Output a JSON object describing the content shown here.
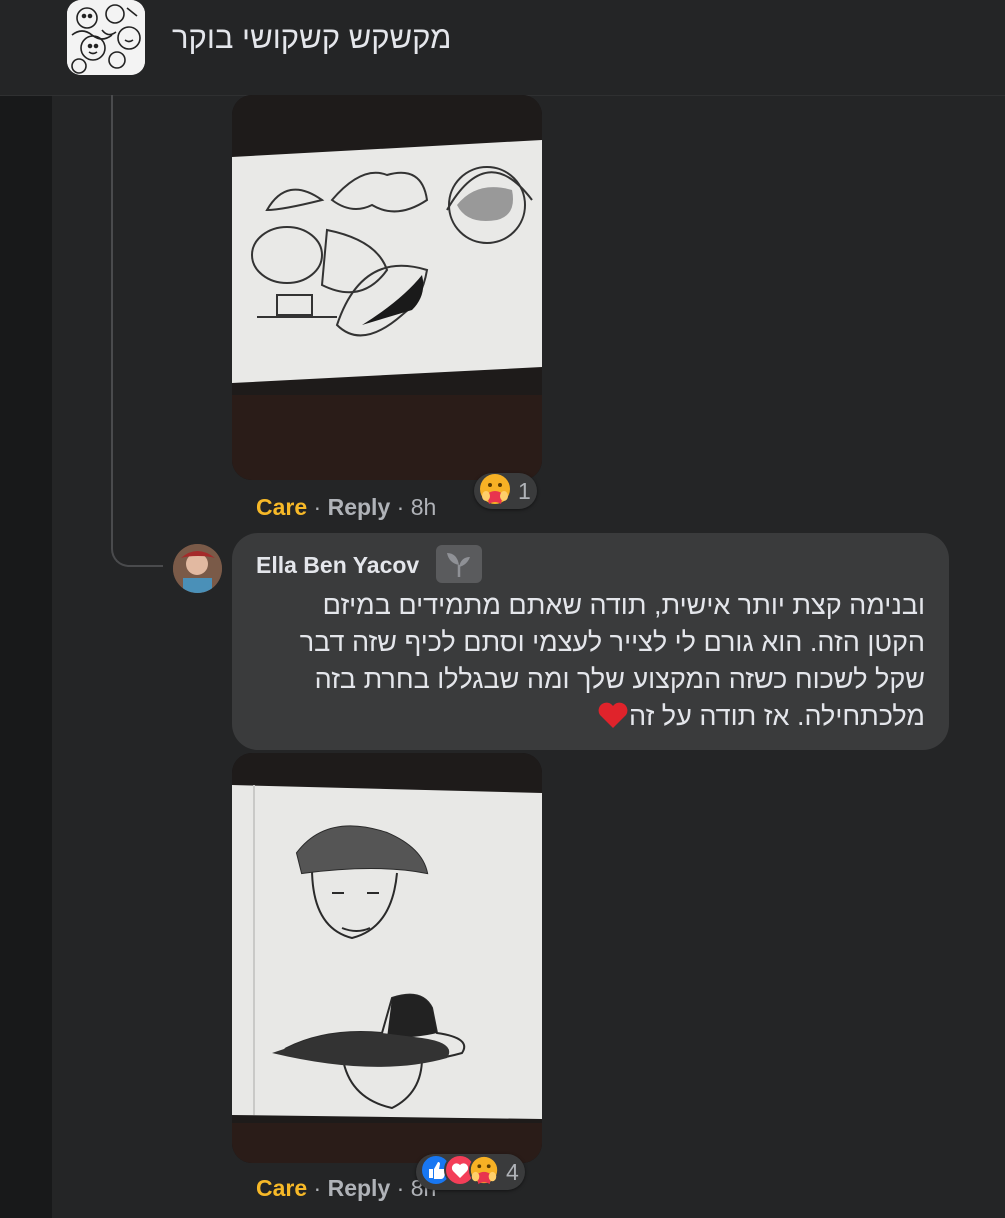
{
  "header": {
    "group_name": "מקשקש קשקושי בוקר"
  },
  "comments": [
    {
      "actions": {
        "care": "Care",
        "reply": "Reply",
        "time": "8h"
      },
      "reaction_count": "1"
    },
    {
      "author": "Ella Ben Yacov",
      "text": "ובנימה קצת יותר אישית, תודה שאתם מתמידים במיזם הקטן הזה. הוא גורם לי לצייר לעצמי וסתם לכיף שזה דבר שקל לשכוח כשזה המקצוע שלך ומה שבגללו בחרת בזה מלכתחילה. אז תודה על זה",
      "actions": {
        "care": "Care",
        "reply": "Reply",
        "time": "8h"
      },
      "reaction_count": "4"
    }
  ],
  "separator": "·",
  "icons": [
    "group-avatar",
    "heart-icon",
    "care-reaction-icon",
    "like-reaction-icon",
    "love-reaction-icon",
    "seedling-badge-icon"
  ],
  "colors": {
    "background": "#242526",
    "bubble": "#3a3b3c",
    "care": "#f7b928",
    "muted": "#b0b3b8"
  }
}
